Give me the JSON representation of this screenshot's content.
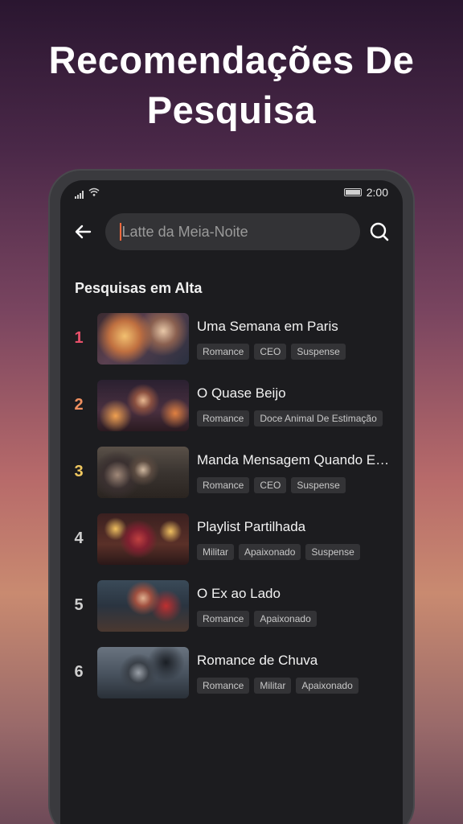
{
  "headline": {
    "line1": "Recomendações De",
    "line2": "Pesquisa"
  },
  "status_bar": {
    "time": "2:00",
    "icons": [
      "signal-icon",
      "wifi-icon",
      "battery-icon"
    ]
  },
  "search": {
    "value": "Latte da Meia-Noite",
    "back_icon": "arrow-left-icon",
    "search_icon": "search-icon"
  },
  "section": {
    "title": "Pesquisas em Alta"
  },
  "colors": {
    "rank1": "#e8506a",
    "rank2": "#f09060",
    "rank3": "#f0c860",
    "rank_default": "#cfcfcf",
    "caret": "#ff6a3d"
  },
  "items": [
    {
      "rank": "1",
      "title": "Uma Semana em Paris",
      "tags": [
        "Romance",
        "CEO",
        "Suspense"
      ]
    },
    {
      "rank": "2",
      "title": "O Quase Beijo",
      "tags": [
        "Romance",
        "Doce Animal De Estimação"
      ]
    },
    {
      "rank": "3",
      "title": "Manda Mensagem Quando Es…",
      "tags": [
        "Romance",
        "CEO",
        "Suspense"
      ]
    },
    {
      "rank": "4",
      "title": "Playlist Partilhada",
      "tags": [
        "Militar",
        "Apaixonado",
        "Suspense"
      ]
    },
    {
      "rank": "5",
      "title": "O Ex ao Lado",
      "tags": [
        "Romance",
        "Apaixonado"
      ]
    },
    {
      "rank": "6",
      "title": "Romance de Chuva",
      "tags": [
        "Romance",
        "Militar",
        "Apaixonado"
      ]
    }
  ]
}
